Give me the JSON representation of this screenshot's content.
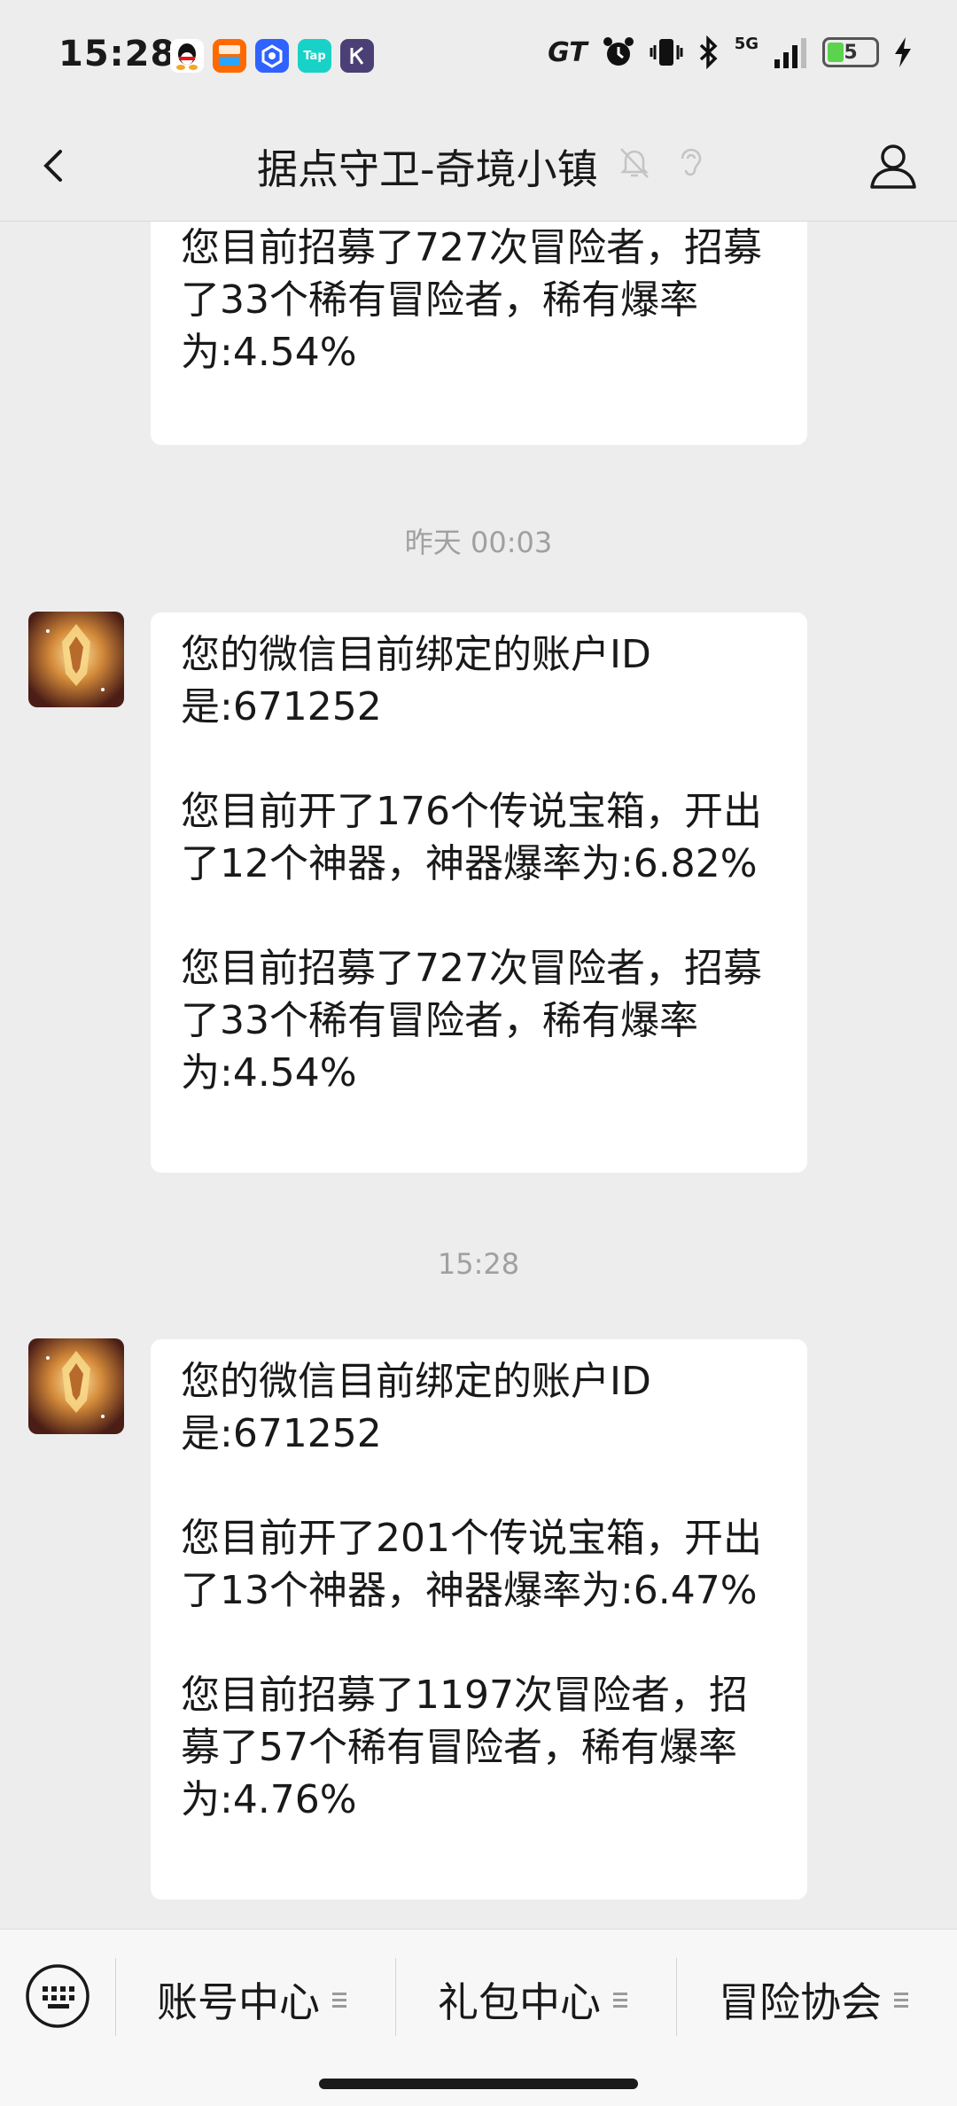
{
  "status_bar": {
    "time": "15:28",
    "network": "5G",
    "battery_level": "5",
    "app_icons": [
      "qq-icon",
      "taobao-icon",
      "app-blue-icon",
      "taptap-icon",
      "k-app-icon"
    ],
    "sys_icons": [
      "gt-icon",
      "alarm-icon",
      "vibrate-icon",
      "bluetooth-icon",
      "signal-icon",
      "battery-icon",
      "charging-icon"
    ]
  },
  "header": {
    "title": "据点守卫-奇境小镇"
  },
  "messages": [
    {
      "lines_a": [
        "您目前招募了727次冒险者，招募了33个稀有冒险者，稀有爆率为:4.54%"
      ]
    },
    {
      "timestamp": "昨天 00:03",
      "p1": "您的微信目前绑定的账户ID是:671252",
      "p2": "您目前开了176个传说宝箱，开出了12个神器，神器爆率为:6.82%",
      "p3": "您目前招募了727次冒险者，招募了33个稀有冒险者，稀有爆率为:4.54%"
    },
    {
      "timestamp": "15:28",
      "p1": "您的微信目前绑定的账户ID是:671252",
      "p2": "您目前开了201个传说宝箱，开出了13个神器，神器爆率为:6.47%",
      "p3": "您目前招募了1197次冒险者，招募了57个稀有冒险者，稀有爆率为:4.76%"
    }
  ],
  "bottom_menu": [
    {
      "label": "账号中心"
    },
    {
      "label": "礼包中心"
    },
    {
      "label": "冒险协会"
    }
  ],
  "colors": {
    "background": "#ededed",
    "bubble": "#ffffff",
    "timestamp": "#a0a0a0"
  }
}
